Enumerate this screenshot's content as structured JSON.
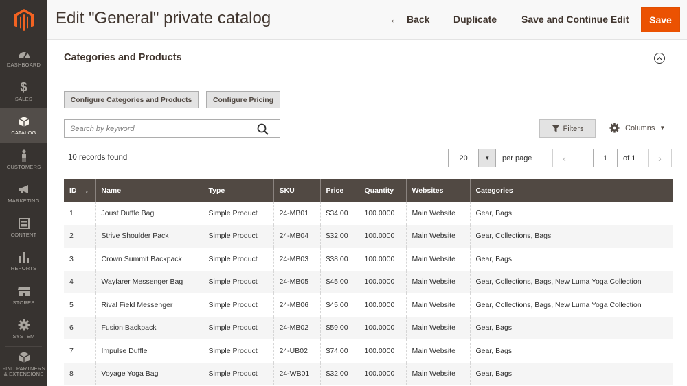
{
  "page": {
    "title": "Edit \"General\" private catalog"
  },
  "header_actions": {
    "back": "Back",
    "duplicate": "Duplicate",
    "save_continue": "Save and Continue Edit",
    "save": "Save"
  },
  "sidebar": {
    "items": [
      {
        "label": "DASHBOARD",
        "icon": "dashboard-icon"
      },
      {
        "label": "SALES",
        "icon": "dollar-icon"
      },
      {
        "label": "CATALOG",
        "icon": "box-icon",
        "active": true
      },
      {
        "label": "CUSTOMERS",
        "icon": "person-icon"
      },
      {
        "label": "MARKETING",
        "icon": "megaphone-icon"
      },
      {
        "label": "CONTENT",
        "icon": "layout-icon"
      },
      {
        "label": "REPORTS",
        "icon": "bar-chart-icon"
      },
      {
        "label": "STORES",
        "icon": "store-icon"
      },
      {
        "label": "SYSTEM",
        "icon": "gear-icon"
      },
      {
        "label_line1": "FIND PARTNERS",
        "label_line2": "& EXTENSIONS",
        "icon": "cube-icon"
      }
    ]
  },
  "section": {
    "title": "Categories and Products",
    "configure_categories": "Configure Categories and Products",
    "configure_pricing": "Configure Pricing"
  },
  "toolbar": {
    "search_placeholder": "Search by keyword",
    "filters": "Filters",
    "columns": "Columns",
    "records_found": "10 records found",
    "per_page_value": "20",
    "per_page_label": "per page",
    "current_page": "1",
    "of_pages": "of 1"
  },
  "table": {
    "headers": [
      "ID",
      "Name",
      "Type",
      "SKU",
      "Price",
      "Quantity",
      "Websites",
      "Categories"
    ],
    "sort_indicator": "↓",
    "rows": [
      [
        "1",
        "Joust Duffle Bag",
        "Simple Product",
        "24-MB01",
        "$34.00",
        "100.0000",
        "Main Website",
        "Gear, Bags"
      ],
      [
        "2",
        "Strive Shoulder Pack",
        "Simple Product",
        "24-MB04",
        "$32.00",
        "100.0000",
        "Main Website",
        "Gear, Collections, Bags"
      ],
      [
        "3",
        "Crown Summit Backpack",
        "Simple Product",
        "24-MB03",
        "$38.00",
        "100.0000",
        "Main Website",
        "Gear, Bags"
      ],
      [
        "4",
        "Wayfarer Messenger Bag",
        "Simple Product",
        "24-MB05",
        "$45.00",
        "100.0000",
        "Main Website",
        "Gear, Collections, Bags, New Luma Yoga Collection"
      ],
      [
        "5",
        "Rival Field Messenger",
        "Simple Product",
        "24-MB06",
        "$45.00",
        "100.0000",
        "Main Website",
        "Gear, Collections, Bags, New Luma Yoga Collection"
      ],
      [
        "6",
        "Fusion Backpack",
        "Simple Product",
        "24-MB02",
        "$59.00",
        "100.0000",
        "Main Website",
        "Gear, Bags"
      ],
      [
        "7",
        "Impulse Duffle",
        "Simple Product",
        "24-UB02",
        "$74.00",
        "100.0000",
        "Main Website",
        "Gear, Bags"
      ],
      [
        "8",
        "Voyage Yoga Bag",
        "Simple Product",
        "24-WB01",
        "$32.00",
        "100.0000",
        "Main Website",
        "Gear, Bags"
      ]
    ]
  },
  "colors": {
    "accent": "#eb5202",
    "sidebar": "#373330",
    "table_header": "#514943"
  }
}
